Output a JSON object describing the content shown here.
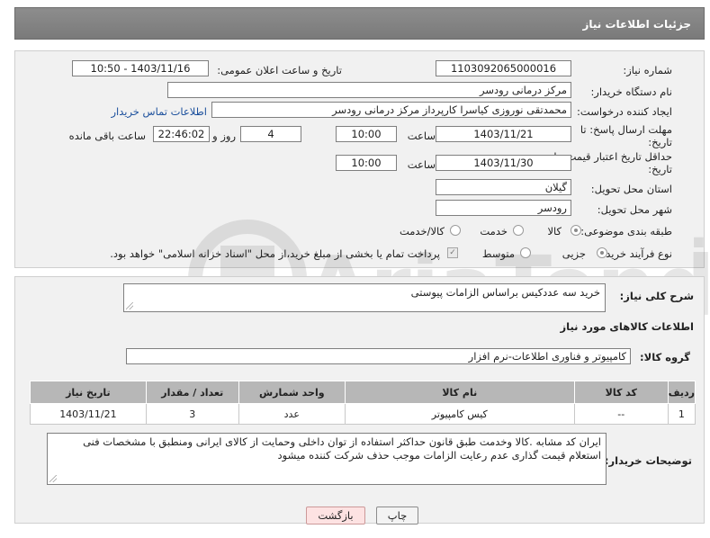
{
  "header": {
    "title": "جزئیات اطلاعات نیاز"
  },
  "form": {
    "need_number": {
      "label": "شماره نیاز:",
      "value": "1103092065000016"
    },
    "announce_datetime": {
      "label": "تاریخ و ساعت اعلان عمومی:",
      "value": "1403/11/16 - 10:50"
    },
    "buyer_org": {
      "label": "نام دستگاه خریدار:",
      "value": "مرکز درمانی رودسر"
    },
    "requester": {
      "label": "ایجاد کننده درخواست:",
      "value": "محمدتقی نوروزی کیاسرا کارپرداز مرکز درمانی رودسر",
      "contact_link": "اطلاعات تماس خریدار"
    },
    "reply_deadline": {
      "label_line1": "مهلت ارسال پاسخ: تا",
      "label_line2": "تاریخ:",
      "date": "1403/11/21",
      "time_label": "ساعت",
      "time": "10:00",
      "days": "4",
      "days_label": "روز و",
      "remaining": "22:46:02",
      "remaining_label": "ساعت باقی مانده"
    },
    "price_validity": {
      "label_line1": "حداقل تاریخ اعتبار قیمت: تا",
      "label_line2": "تاریخ:",
      "date": "1403/11/30",
      "time_label": "ساعت",
      "time": "10:00"
    },
    "delivery_province": {
      "label": "استان محل تحویل:",
      "value": "گیلان"
    },
    "delivery_city": {
      "label": "شهر محل تحویل:",
      "value": "رودسر"
    },
    "category": {
      "label": "طبقه بندی موضوعی:",
      "options": [
        "کالا",
        "خدمت",
        "کالا/خدمت"
      ],
      "selected": "کالا"
    },
    "purchase_type": {
      "label": "نوع فرآیند خرید :",
      "options": [
        "جزیی",
        "متوسط"
      ],
      "selected": "جزیی",
      "payment_note": "پرداخت تمام یا بخشی از مبلغ خرید،از محل \"اسناد خزانه اسلامی\" خواهد بود."
    }
  },
  "description": {
    "label": "شرح کلی نیاز:",
    "value": "خرید سه عددکیس براساس الزامات پیوستی"
  },
  "goods_section": {
    "title": "اطلاعات کالاهای مورد نیاز",
    "group_label": "گروه کالا:",
    "group_value": "کامپیوتر و فناوری اطلاعات-نرم افزار"
  },
  "table": {
    "headers": [
      "ردیف",
      "کد کالا",
      "نام کالا",
      "واحد شمارش",
      "تعداد / مقدار",
      "تاریخ نیاز"
    ],
    "rows": [
      [
        "1",
        "--",
        "کیس کامپیوتر",
        "عدد",
        "3",
        "1403/11/21"
      ]
    ]
  },
  "buyer_notes": {
    "label": "توضیحات خریدار:",
    "value": "ایران کد مشابه .کالا وخدمت طبق قانون حداکثر استفاده از توان داخلی وحمایت از کالای ایرانی ومنطبق با مشخصات فنی استعلام قیمت گذاری عدم رعایت الزامات موجب حذف شرکت کننده میشود"
  },
  "buttons": {
    "print": "چاپ",
    "back": "بازگشت"
  },
  "colors": {
    "header_bg": "#7f7f7f",
    "table_header_bg": "#b7b7b7",
    "link": "#1b4f9c",
    "back_button_bg": "#fde2e2"
  }
}
